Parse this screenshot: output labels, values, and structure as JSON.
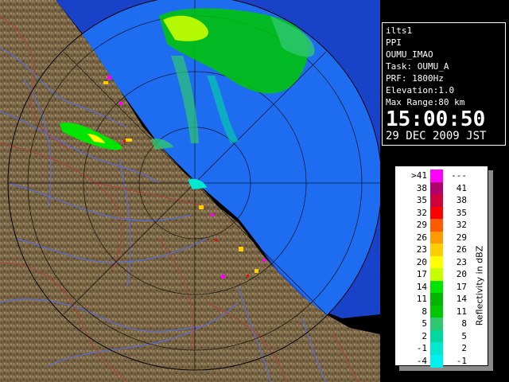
{
  "info": {
    "lines": [
      "ilts1",
      "PPI",
      "OUMU_IMAO",
      "Task: OUMU_A",
      "PRF: 1800Hz",
      "Elevation:1.0",
      "Max Range:80 km"
    ],
    "time": "15:00:50",
    "date": "29 DEC 2009 JST"
  },
  "legend": {
    "unit": "Reflectivity in dBZ",
    "rows": [
      {
        "lo": ">41",
        "hi": "---",
        "color": "#ff00ff"
      },
      {
        "lo": "38",
        "hi": "41",
        "color": "#b0006e"
      },
      {
        "lo": "35",
        "hi": "38",
        "color": "#d0003a"
      },
      {
        "lo": "32",
        "hi": "35",
        "color": "#ff0000"
      },
      {
        "lo": "29",
        "hi": "32",
        "color": "#ff5a00"
      },
      {
        "lo": "26",
        "hi": "29",
        "color": "#ff9a00"
      },
      {
        "lo": "23",
        "hi": "26",
        "color": "#ffce00"
      },
      {
        "lo": "20",
        "hi": "23",
        "color": "#ffff00"
      },
      {
        "lo": "17",
        "hi": "20",
        "color": "#c8ff00"
      },
      {
        "lo": "14",
        "hi": "17",
        "color": "#00e400"
      },
      {
        "lo": "11",
        "hi": "14",
        "color": "#00b400"
      },
      {
        "lo": "8",
        "hi": "11",
        "color": "#00c800"
      },
      {
        "lo": "5",
        "hi": "8",
        "color": "#2ec870"
      },
      {
        "lo": "2",
        "hi": "5",
        "color": "#00d8a0"
      },
      {
        "lo": "-1",
        "hi": "2",
        "color": "#00e8d0"
      },
      {
        "lo": "-4",
        "hi": "-1",
        "color": "#00f0f0"
      }
    ]
  },
  "colors": {
    "sea": "#1e6cf0",
    "outer_sea": "#1842c8",
    "land": "#7a6545",
    "rivers": "#5a6cd8",
    "boundaries": "#b04040"
  }
}
